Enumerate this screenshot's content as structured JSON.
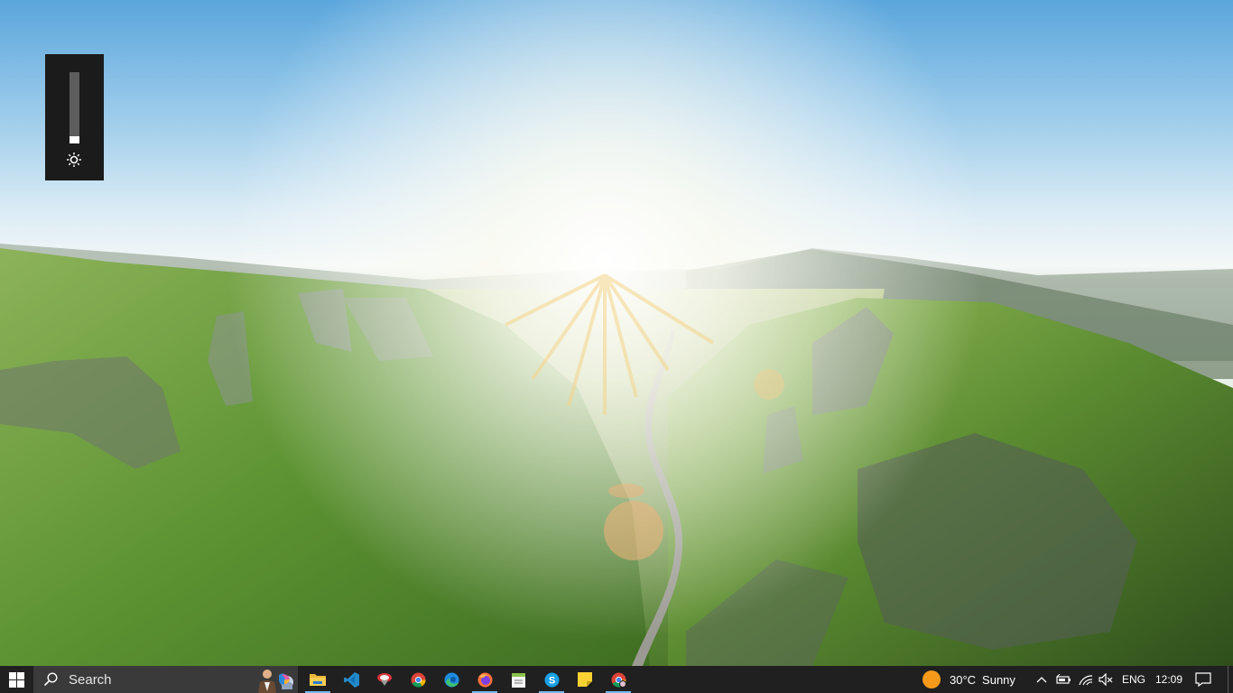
{
  "brightness": {
    "level": 0.1,
    "icon": "brightness-icon"
  },
  "taskbar": {
    "start_icon": "windows-logo-icon",
    "search": {
      "label": "Search",
      "icon": "search-icon"
    },
    "pinned_apps": [
      {
        "name": "copilot",
        "icon": "copilot-icon"
      },
      {
        "name": "file-explorer",
        "icon": "folder-icon",
        "active": true
      },
      {
        "name": "vscode",
        "icon": "vscode-icon"
      },
      {
        "name": "app",
        "icon": "app-icon"
      },
      {
        "name": "chrome",
        "icon": "chrome-icon"
      },
      {
        "name": "edge",
        "icon": "edge-icon"
      },
      {
        "name": "firefox",
        "icon": "firefox-icon",
        "active": true
      },
      {
        "name": "notepad",
        "icon": "notepad-icon"
      },
      {
        "name": "skype",
        "icon": "skype-icon",
        "active": true
      },
      {
        "name": "sticky-notes",
        "icon": "sticky-notes-icon"
      },
      {
        "name": "chrome-profile",
        "icon": "chrome-icon",
        "active": true
      }
    ],
    "weather": {
      "temperature": "30°C",
      "condition": "Sunny",
      "icon": "sun-icon"
    },
    "tray": {
      "chevron_icon": "chevron-up-icon",
      "battery_icon": "battery-icon",
      "network_icon": "wifi-icon",
      "volume_icon": "volume-muted-icon",
      "language": "ENG",
      "time": "12:09",
      "notification_icon": "notification-icon"
    },
    "accent_color": "#76b9ed"
  }
}
